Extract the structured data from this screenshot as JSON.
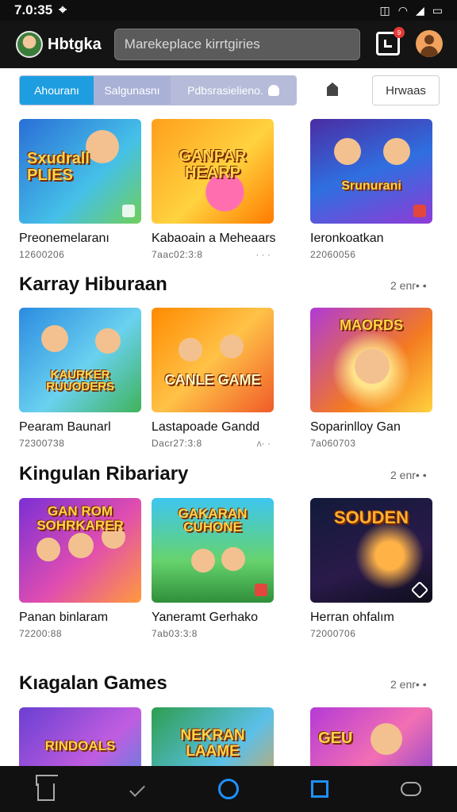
{
  "status_bar": {
    "time": "7.0:35",
    "icons": [
      "location-icon",
      "vibrate-icon",
      "wifi-icon",
      "signal-icon",
      "battery-icon"
    ]
  },
  "app_bar": {
    "title": "Hbtgka",
    "search_placeholder": "Marekeplace kirrtgiries",
    "notification_badge": "9"
  },
  "tabs": [
    {
      "label": "Ahouranı"
    },
    {
      "label": "Salgunasnı"
    },
    {
      "label": "Pdbsrasielieno."
    }
  ],
  "filter_label": "Hrwaas",
  "sections": [
    {
      "title": "",
      "cards": [
        {
          "name": "Preonemelaranı",
          "meta": "12600206",
          "art_text": "Sxudrall PLIES"
        },
        {
          "name": "Kabaoain a Meheaars",
          "meta": "7aac02:3:8",
          "art_text": "GANPAR HEARP",
          "more": "· · ·"
        },
        {
          "name": "Ieronkoatkan",
          "meta": "22060056",
          "art_text": "Srunurani"
        }
      ]
    },
    {
      "title": "Karray Hiburaan",
      "see_all": "2 enr• •",
      "cards": [
        {
          "name": "Pearam Baunarl",
          "meta": "72300738",
          "art_text": "KAURKER RUUODERS"
        },
        {
          "name": "Lastapoade Gandd",
          "meta": "Dacr27:3:8",
          "art_text": "CANLE GAME",
          "more": "ʌ· ·"
        },
        {
          "name": "Soparinlloy Gan",
          "meta": "7a060703",
          "art_text": "MAORDS"
        }
      ]
    },
    {
      "title": "Kingulan Ribariary",
      "see_all": "2 enr• •",
      "cards": [
        {
          "name": "Panan binlaram",
          "meta": "72200:88",
          "art_text": "GAN ROM SOHRKARER"
        },
        {
          "name": "Yaneramt Gerhako",
          "meta": "7ab03:3:8",
          "art_text": "GAKARAN CUHONE"
        },
        {
          "name": "Herran ohfalım",
          "meta": "72000706",
          "art_text": "SOUDEN"
        }
      ]
    },
    {
      "title": "Kıagalan Games",
      "see_all": "2 enr• •",
      "cards": [
        {
          "name": "",
          "meta": "",
          "art_text": "RINDOALS"
        },
        {
          "name": "",
          "meta": "",
          "art_text": "NEKRAN LAAME"
        },
        {
          "name": "",
          "meta": "",
          "art_text": "GEU"
        }
      ]
    }
  ],
  "bottom_nav": [
    "home-icon",
    "check-icon",
    "circle-icon",
    "square-icon",
    "cloud-icon"
  ],
  "colors": {
    "accent": "#1e9ee0",
    "nav_blue": "#1e90ff",
    "app_bar": "#141414",
    "search_bg": "#5b5b5b"
  }
}
